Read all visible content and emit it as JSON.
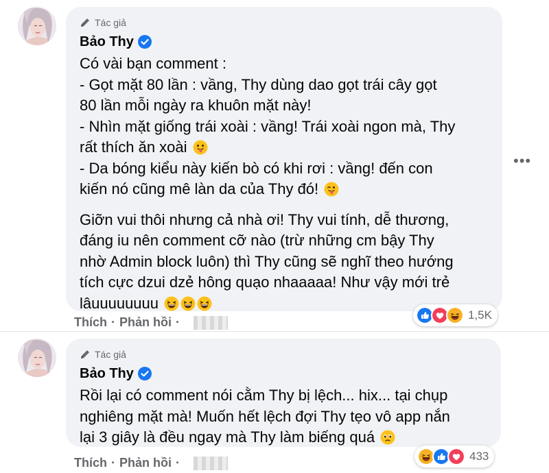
{
  "comments": [
    {
      "role_label": "Tác giả",
      "author": "Bảo Thy",
      "verified": true,
      "lines": [
        "Có vài bạn comment :",
        "- Gọt mặt 80 lần : vầng, Thy dùng dao gọt trái cây gọt",
        "80 lần mỗi ngày ra khuôn mặt này!",
        "- Nhìn mặt giống trái xoài : vầng! Trái xoài ngon mà, Thy",
        "rất thích ăn xoài",
        "- Da bóng kiểu này kiến bò có khi rơi : vầng! đến con",
        "kiến nó cũng mê làn da của Thy đó!"
      ],
      "lines2": [
        "Giỡn vui thôi nhưng cả nhà ơi! Thy vui tính, dễ thương,",
        "đáng iu nên comment cỡ nào (trừ những cm bậy Thy",
        "nhờ Admin block luôn) thì Thy cũng sẽ nghĩ theo hướng",
        "tích cực dzui dzẻ hông quạo nhaaaaa! Như vậy mới trẻ",
        "lâuuuuuuuu"
      ],
      "like_label": "Thích",
      "reply_label": "Phản hồi",
      "reaction_count": "1,5K",
      "reaction_icons": [
        "like",
        "love",
        "haha"
      ]
    },
    {
      "role_label": "Tác giả",
      "author": "Bảo Thy",
      "verified": true,
      "lines": [
        "Rồi lại có comment nói cằm Thy bị lệch... hix... tại chụp",
        "nghiêng mặt mà! Muốn hết lệch đợi Thy tẹo vô app nắn",
        "lại 3 giây là đều ngay mà Thy làm biếng quá"
      ],
      "like_label": "Thích",
      "reply_label": "Phản hồi",
      "reaction_count": "433",
      "reaction_icons": [
        "haha",
        "like",
        "love"
      ]
    }
  ],
  "more_icon": "more-horizontal-icon",
  "colors": {
    "bubble": "#f0f2f5",
    "meta": "#65676b",
    "verified": "#1877f2",
    "like": "#1877f2",
    "love": "#f33e58",
    "haha": "#f7b125"
  }
}
